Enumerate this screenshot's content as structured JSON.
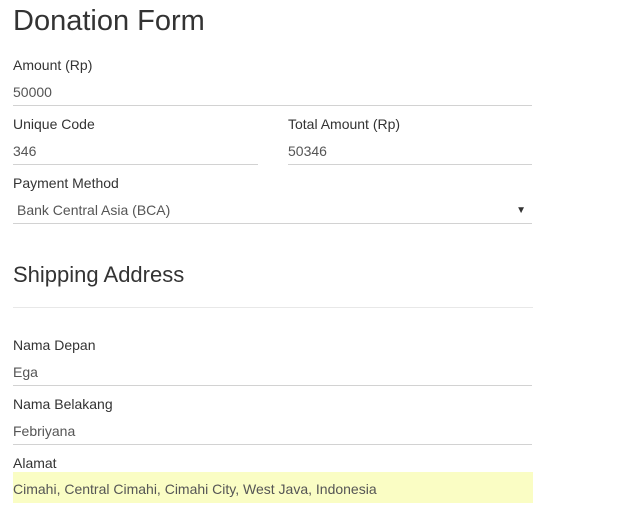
{
  "form": {
    "title": "Donation Form",
    "amount": {
      "label": "Amount (Rp)",
      "value": "50000"
    },
    "unique_code": {
      "label": "Unique Code",
      "value": "346"
    },
    "total_amount": {
      "label": "Total Amount (Rp)",
      "value": "50346"
    },
    "payment_method": {
      "label": "Payment Method",
      "value": "Bank Central Asia (BCA)",
      "icon": "caret-down-icon"
    }
  },
  "shipping": {
    "title": "Shipping Address",
    "first_name": {
      "label": "Nama Depan",
      "value": "Ega"
    },
    "last_name": {
      "label": "Nama Belakang",
      "value": "Febriyana"
    },
    "address": {
      "label": "Alamat",
      "value": "Cimahi, Central Cimahi, Cimahi City, West Java, Indonesia",
      "highlight_color": "#fafdc4"
    }
  }
}
